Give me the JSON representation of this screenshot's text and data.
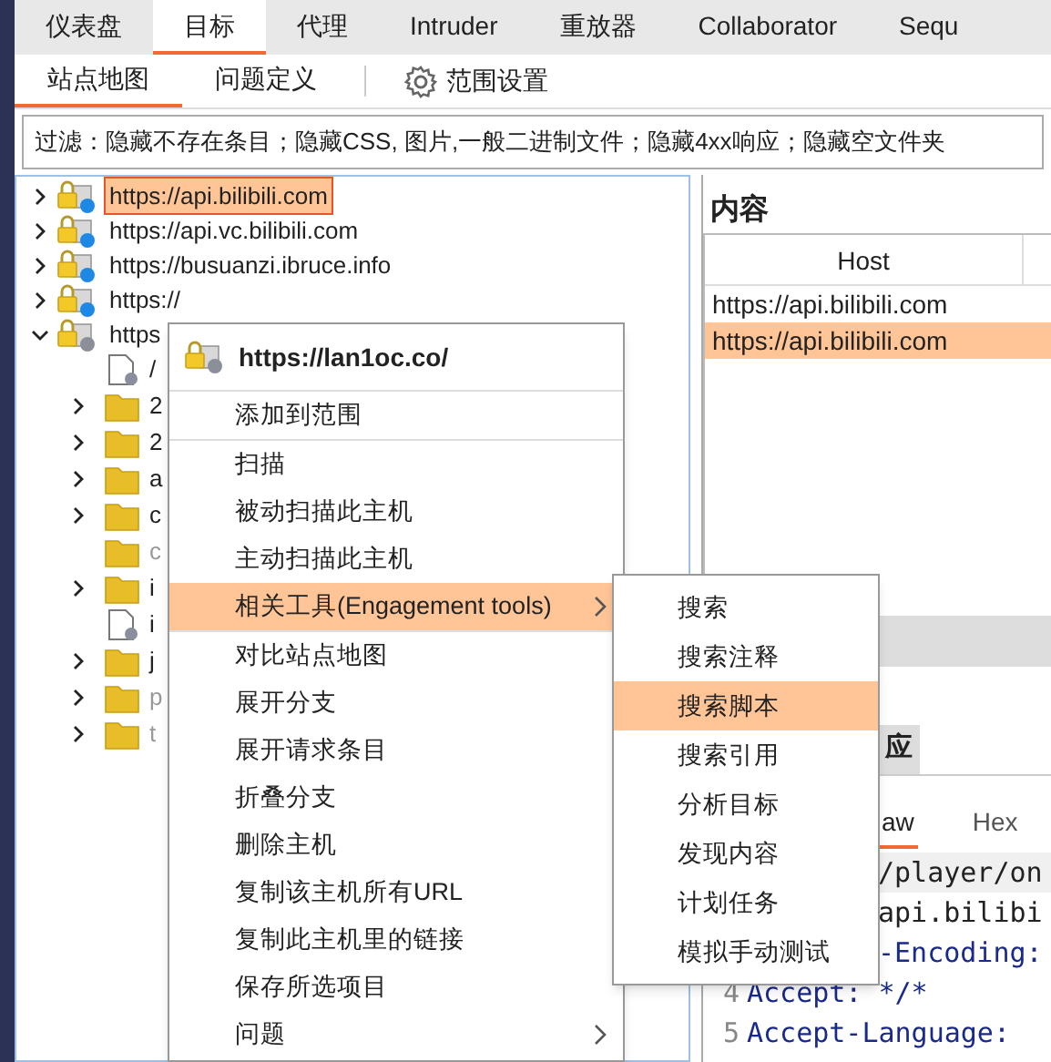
{
  "tabs": [
    {
      "label": "仪表盘",
      "selected": false
    },
    {
      "label": "目标",
      "selected": true
    },
    {
      "label": "代理",
      "selected": false
    },
    {
      "label": "Intruder",
      "selected": false
    },
    {
      "label": "重放器",
      "selected": false
    },
    {
      "label": "Collaborator",
      "selected": false
    },
    {
      "label": "Sequ",
      "selected": false
    }
  ],
  "subtabs": [
    {
      "label": "站点地图",
      "selected": true
    },
    {
      "label": "问题定义",
      "selected": false
    }
  ],
  "scope_button": "范围设置",
  "filter": "过滤：隐藏不存在条目；隐藏CSS, 图片,一般二进制文件；隐藏4xx响应；隐藏空文件夹",
  "site_tree": [
    {
      "label": "https://api.bilibili.com",
      "expanded": false,
      "selected": true,
      "color": "#1e88e5"
    },
    {
      "label": "https://api.vc.bilibili.com",
      "expanded": false,
      "selected": false,
      "color": "#1e88e5"
    },
    {
      "label": "https://busuanzi.ibruce.info",
      "expanded": false,
      "selected": false,
      "color": "#1e88e5"
    },
    {
      "label": "https://",
      "expanded": false,
      "selected": false,
      "color": "#1e88e5"
    },
    {
      "label": "https",
      "expanded": true,
      "selected": false,
      "color": "#8a8f99",
      "children": [
        {
          "kind": "file",
          "label": "/",
          "expandable": false,
          "dimmed": false
        },
        {
          "kind": "folder",
          "label": "2",
          "expandable": true,
          "dimmed": false
        },
        {
          "kind": "folder",
          "label": "2",
          "expandable": true,
          "dimmed": false
        },
        {
          "kind": "folder",
          "label": "a",
          "expandable": true,
          "dimmed": false
        },
        {
          "kind": "folder",
          "label": "c",
          "expandable": true,
          "dimmed": false
        },
        {
          "kind": "folder",
          "label": "c",
          "expandable": false,
          "dimmed": true
        },
        {
          "kind": "folder",
          "label": "i",
          "expandable": true,
          "dimmed": false
        },
        {
          "kind": "file",
          "label": "i",
          "expandable": false,
          "dimmed": false
        },
        {
          "kind": "folder",
          "label": "j",
          "expandable": true,
          "dimmed": false
        },
        {
          "kind": "folder",
          "label": "p",
          "expandable": true,
          "dimmed": true
        },
        {
          "kind": "folder",
          "label": "t",
          "expandable": true,
          "dimmed": true
        }
      ]
    }
  ],
  "contents": {
    "title": "内容",
    "columns": [
      "Host"
    ],
    "rows": [
      {
        "cells": [
          "https://api.bilibili.com"
        ],
        "selected": false
      },
      {
        "cells": [
          "https://api.bilibili.com"
        ],
        "selected": true
      }
    ]
  },
  "message_tabs": {
    "outer": [
      {
        "label": "应",
        "selected": false
      }
    ],
    "inner": [
      {
        "label": "aw",
        "selected": true
      },
      {
        "label": "Hex",
        "selected": false
      }
    ]
  },
  "code_lines": [
    {
      "text": "/player/on",
      "kind": "path"
    },
    {
      "text": "api.bilibi",
      "kind": "value"
    },
    {
      "text": "-Encoding:",
      "kind": "header"
    },
    {
      "number": "4",
      "text": "Accept: */*",
      "kind": "header"
    },
    {
      "number": "5",
      "text": "Accept-Language:",
      "kind": "header"
    }
  ],
  "context_menu": {
    "title": "https://lan1oc.co/",
    "items": [
      {
        "label": "添加到范围",
        "selected": false,
        "submenu": false,
        "divider_after": true
      },
      {
        "label": "扫描",
        "selected": false,
        "submenu": false,
        "divider_after": false
      },
      {
        "label": "被动扫描此主机",
        "selected": false,
        "submenu": false,
        "divider_after": false
      },
      {
        "label": "主动扫描此主机",
        "selected": false,
        "submenu": false,
        "divider_after": false
      },
      {
        "label": "相关工具(Engagement tools)",
        "selected": true,
        "submenu": true,
        "divider_after": true
      },
      {
        "label": "对比站点地图",
        "selected": false,
        "submenu": false,
        "divider_after": false
      },
      {
        "label": "展开分支",
        "selected": false,
        "submenu": false,
        "divider_after": false
      },
      {
        "label": "展开请求条目",
        "selected": false,
        "submenu": false,
        "divider_after": false
      },
      {
        "label": "折叠分支",
        "selected": false,
        "submenu": false,
        "divider_after": false
      },
      {
        "label": "删除主机",
        "selected": false,
        "submenu": false,
        "divider_after": false
      },
      {
        "label": "复制该主机所有URL",
        "selected": false,
        "submenu": false,
        "divider_after": false
      },
      {
        "label": "复制此主机里的链接",
        "selected": false,
        "submenu": false,
        "divider_after": false
      },
      {
        "label": "保存所选项目",
        "selected": false,
        "submenu": false,
        "divider_after": false
      },
      {
        "label": "问题",
        "selected": false,
        "submenu": true,
        "divider_after": false
      }
    ]
  },
  "submenu": [
    {
      "label": "搜索",
      "selected": false
    },
    {
      "label": "搜索注释",
      "selected": false
    },
    {
      "label": "搜索脚本",
      "selected": true
    },
    {
      "label": "搜索引用",
      "selected": false
    },
    {
      "label": "分析目标",
      "selected": false
    },
    {
      "label": "发现内容",
      "selected": false
    },
    {
      "label": "计划任务",
      "selected": false
    },
    {
      "label": "模拟手动测试",
      "selected": false
    }
  ]
}
